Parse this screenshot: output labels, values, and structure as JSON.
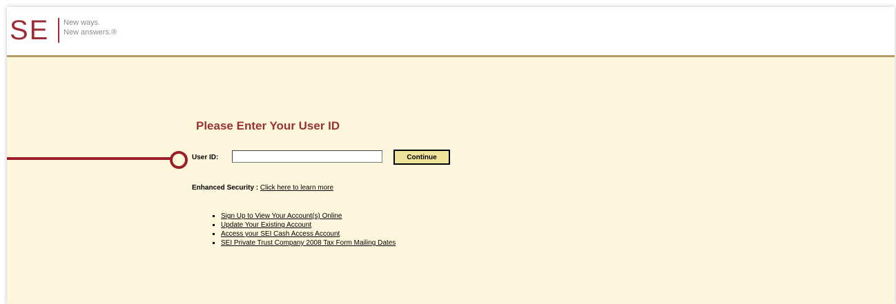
{
  "header": {
    "logo_text": "SE",
    "tagline_line1": "New ways.",
    "tagline_line2": "New answers.®"
  },
  "login": {
    "title": "Please Enter Your User ID",
    "userid_label": "User ID:",
    "userid_value": "",
    "continue_label": "Continue"
  },
  "security": {
    "label": "Enhanced Security :",
    "link": "Click here to learn more"
  },
  "links": [
    "Sign Up to View Your Account(s) Online",
    "Update Your Existing Account",
    "Access your SEI Cash Access Account",
    "SEI Private Trust Company 2008 Tax Form Mailing Dates"
  ],
  "colors": {
    "brand": "#9b2b34",
    "title": "#993333",
    "background": "#fbf6dc",
    "button": "#efe29a",
    "header_rule": "#b89a66"
  }
}
